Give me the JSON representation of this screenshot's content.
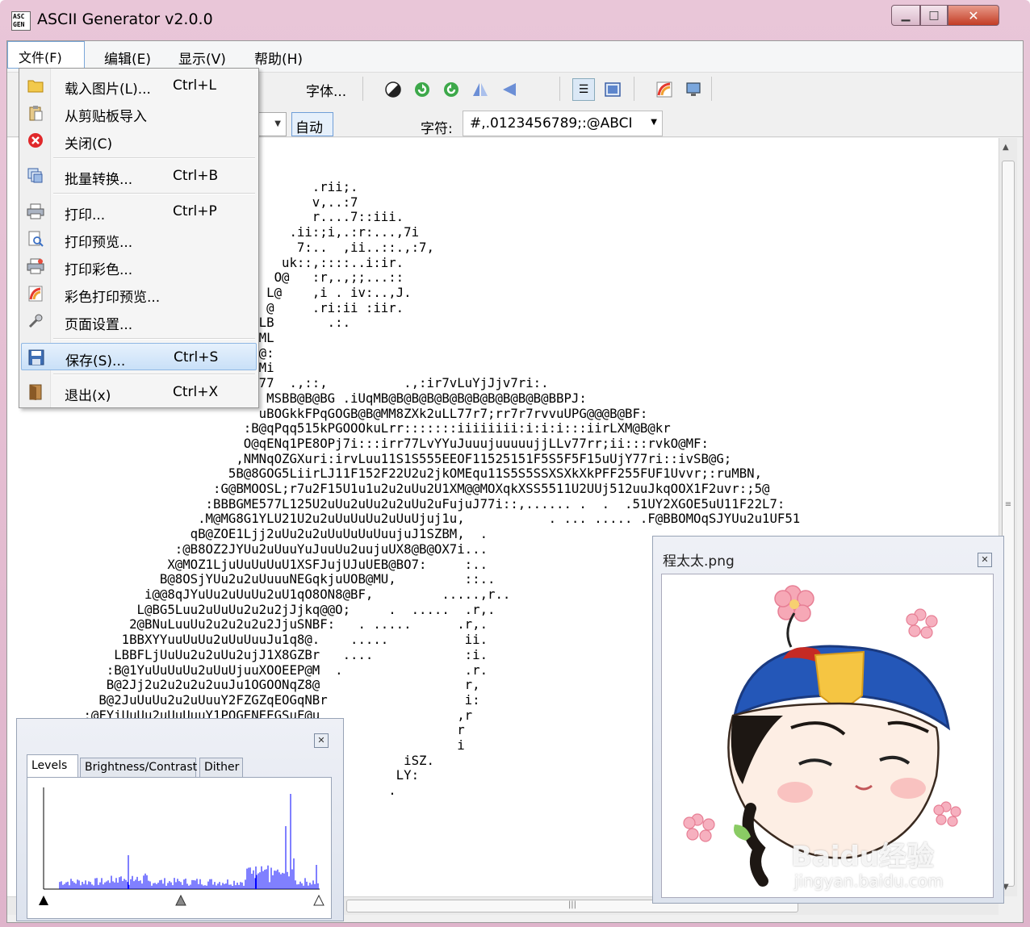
{
  "window": {
    "title": "ASCII Generator v2.0.0",
    "app_icon_text": "ASC GEN"
  },
  "menubar": {
    "file": "文件(F)",
    "edit": "编辑(E)",
    "view": "显示(V)",
    "help": "帮助(H)"
  },
  "toolbar": {
    "font_label": "字体...",
    "auto_label": "自动",
    "chars_label": "字符:",
    "chars_value": "#,.0123456789;:@ABCI"
  },
  "file_menu": [
    {
      "icon": "folder-open-icon",
      "label": "载入图片(L)...",
      "shortcut": "Ctrl+L"
    },
    {
      "icon": "clipboard-icon",
      "label": "从剪贴板导入",
      "shortcut": ""
    },
    {
      "icon": "close-icon",
      "label": "关闭(C)",
      "shortcut": ""
    },
    {
      "icon": "batch-convert-icon",
      "label": "批量转换...",
      "shortcut": "Ctrl+B"
    },
    {
      "icon": "printer-icon",
      "label": "打印...",
      "shortcut": "Ctrl+P"
    },
    {
      "icon": "print-preview-icon",
      "label": "打印预览...",
      "shortcut": ""
    },
    {
      "icon": "color-printer-icon",
      "label": "打印彩色...",
      "shortcut": ""
    },
    {
      "icon": "color-print-preview-icon",
      "label": "彩色打印预览...",
      "shortcut": ""
    },
    {
      "icon": "page-setup-icon",
      "label": "页面设置...",
      "shortcut": ""
    },
    {
      "icon": "save-disk-icon",
      "label": "保存(S)...",
      "shortcut": "Ctrl+S"
    },
    {
      "icon": "exit-door-icon",
      "label": "退出(x)",
      "shortcut": "Ctrl+X"
    }
  ],
  "ascii_output": "                                        .rii;.\n                                        v,..:7\n                                        r....7::iii.\n                                     .ii:;i,.:r:...,7i\n                                      7:..  ,ii..::.,:7,\n                                    uk::,::::..i:ir.\n                                   O@   :r,.,;;...::\n                                  L@    ,i . iv:..,J.\n                                  @     .ri:ii :iir.\n                                 LB       .:.\n                                 ML\n                                 @:\n                                 Mi\n                                 77  .,::,          .,:ir7vLuYjJjv7ri:.\n                                  MSBB@B@BG .iUqMB@B@B@B@B@B@B@B@B@B@B@BBPJ:\n                                 uBOGkkFPqGOGB@B@MM8ZXk2uLL77r7;rr7r7rvvuUPG@@@B@BF:\n                               :B@qPqq515kPGOOOkuLrr:::::::iiiiiiii:i:i:i:::iirLXM@B@kr\n                               O@qENq1PE8OPj7i:::irr77LvYYuJuuujuuuuujjLLv77rr;ii:::rvkO@MF:\n                              ,NMNqOZGXuri:irvLuu11S1S555EEOF11525151F5S5F5F15uUjY77ri::ivSB@G;\n                             5B@8GOG5LiirLJ11F152F22U2u2jkOMEqu11S5S5SSXSXkXkPFF255FUF1Uvvr;:ruMBN,\n                           :G@BMOOSL;r7u2F15U1u1u2u2uUu2U1XM@@MOXqkXSS5511U2UUj512uuJkqOOX1F2uvr:;5@\n                          :BBBGME577L125U2uUu2uUu2u2uUu2uFujuJ77i::,...... .  .  .51UY2XGOE5uU11F22L7:\n                         .M@MG8G1YLU21U2u2uUuUuUu2uUuUjuj1u,           . ... ..... .F@BBOMOqSJYUu2u1UF51\n                        qB@ZOE1Ljj2uUu2u2uUuUuUuUuujuJ1SZBM,  .\n                      :@B8OZ2JYUu2uUuuYuJuuUu2uujuUX8@B@OX7i...\n                     X@MOZ1LjuUuUuUuU1XSFJujUJuUEB@BO7:     :..\n                    B@8OSjYUu2u2uUuuuNEGqkjuUOB@MU,         ::..\n                  i@@8qJYuUu2uUuUu2uU1qO8ON8@BF,         .....,r..\n                 L@BG5Luu2uUuUu2u2u2jJjkq@@O;     .  .....  .r,.\n                2@BNuLuuUu2u2u2u2u2JjuSNBF:   . .....      .r,.\n               1BBXYYuuUuUu2uUuUuuJu1q8@.    .....          ii.\n              LBBFLjUuUu2u2uUu2ujJ1X8GZBr   ....            :i.\n             :B@1YuUuUuUu2uUuUjuuXOOEEP@M  .                .r.\n             B@2Jj2u2u2u2u2uuJu1OGOONqZ8@                   r,\n            B@2JuUuUu2u2uUuuY2FZGZqEOGqNBr                  i:\n          :@FYiUuUu2uUuUuuY1POGENEEGSuF@u                  ,r\n          OGMYUu2uUuUuUu2uUJNOGMX0OZ52u5BE                 r\n          ONMY2uUuUuUu2uUjYONNMNONU221u@O                  i\n          BMOJ2uUu2uUu2uYSENOXBOE221F1U@B           iSZ.\n          BMGYUuUu2uUuUYkONqqMOXU2555j@B           LY:\n          BMOYUu2uUu2uYSGNEPOMXuF1F22BB           .\n          BMGJ2uUuUu2YkOEOEFXB5U151Fj@G\n          B@EjUu2uUu2jNMONXLPM12F5F1UB5\n          B@BjUuUu2uYBMB@OUuPBu15525u@i\n          G@BFUu2u2uSBB@Bq2uOMU1S152qB\n          u@B8uUuUuuSMB@B8uUqOjF1F2UBM\n          i@BGuUuU2uSMB@BOUuqZU1F112@:",
  "levels_panel": {
    "tabs": [
      "Levels",
      "Brightness/Contrast",
      "Dither"
    ],
    "active_tab": "Levels"
  },
  "preview_panel": {
    "title": "程太太.png"
  },
  "watermark": {
    "brand": "Baidu经验",
    "url": "jingyan.baidu.com"
  },
  "colors": {
    "title_bar": "#e6c1d5",
    "selection": "#cde3f8",
    "histogram": "#0000ff",
    "cap_blue": "#2457b8",
    "cap_red": "#c52a24",
    "cap_badge": "#f5c542"
  }
}
